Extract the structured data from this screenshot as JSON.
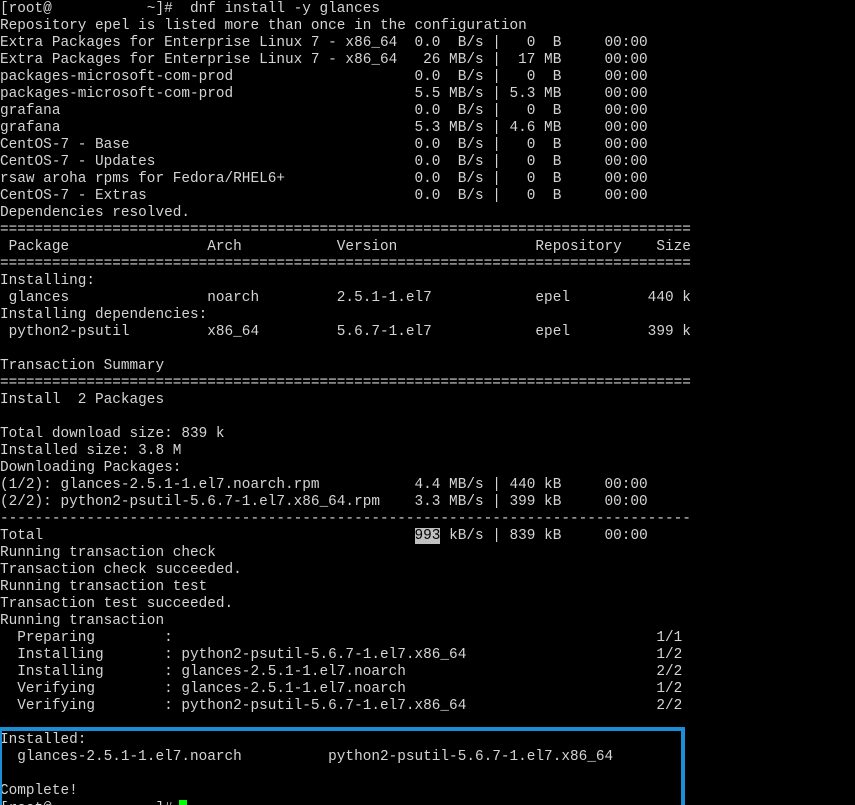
{
  "terminal": {
    "lines": [
      "[root@           ~]#  dnf install -y glances",
      "Repository epel is listed more than once in the configuration",
      "Extra Packages for Enterprise Linux 7 - x86_64  0.0  B/s |   0  B     00:00",
      "Extra Packages for Enterprise Linux 7 - x86_64   26 MB/s |  17 MB     00:00",
      "packages-microsoft-com-prod                     0.0  B/s |   0  B     00:00",
      "packages-microsoft-com-prod                     5.5 MB/s | 5.3 MB     00:00",
      "grafana                                         0.0  B/s |   0  B     00:00",
      "grafana                                         5.3 MB/s | 4.6 MB     00:00",
      "CentOS-7 - Base                                 0.0  B/s |   0  B     00:00",
      "CentOS-7 - Updates                              0.0  B/s |   0  B     00:00",
      "rsaw aroha rpms for Fedora/RHEL6+               0.0  B/s |   0  B     00:00",
      "CentOS-7 - Extras                               0.0  B/s |   0  B     00:00",
      "Dependencies resolved.",
      "================================================================================",
      " Package                Arch           Version                Repository    Size",
      "================================================================================",
      "Installing:",
      " glances                noarch         2.5.1-1.el7            epel         440 k",
      "Installing dependencies:",
      " python2-psutil         x86_64         5.6.7-1.el7            epel         399 k",
      "",
      "Transaction Summary",
      "================================================================================",
      "Install  2 Packages",
      "",
      "Total download size: 839 k",
      "Installed size: 3.8 M",
      "Downloading Packages:",
      "(1/2): glances-2.5.1-1.el7.noarch.rpm           4.4 MB/s | 440 kB     00:00",
      "(2/2): python2-psutil-5.6.7-1.el7.x86_64.rpm    3.3 MB/s | 399 kB     00:00",
      "--------------------------------------------------------------------------------",
      "Total                                           993 kB/s | 839 kB     00:00",
      "Running transaction check",
      "Transaction check succeeded.",
      "Running transaction test",
      "Transaction test succeeded.",
      "Running transaction",
      "  Preparing        :                                                        1/1",
      "  Installing       : python2-psutil-5.6.7-1.el7.x86_64                      1/2",
      "  Installing       : glances-2.5.1-1.el7.noarch                             2/2",
      "  Verifying        : glances-2.5.1-1.el7.noarch                             1/2",
      "  Verifying        : python2-psutil-5.6.7-1.el7.x86_64                      2/2",
      "",
      "Installed:",
      "  glances-2.5.1-1.el7.noarch          python2-psutil-5.6.7-1.el7.x86_64",
      "",
      "Complete!",
      "[root@           ~]#"
    ],
    "highlight": {
      "line_index": 31,
      "text": "993"
    },
    "colors": {
      "background": "#000000",
      "foreground": "#d4d4d4",
      "cursor": "#00ff00",
      "selection": "#c0c0c0",
      "annotation_box": "#1a8fd6"
    }
  }
}
